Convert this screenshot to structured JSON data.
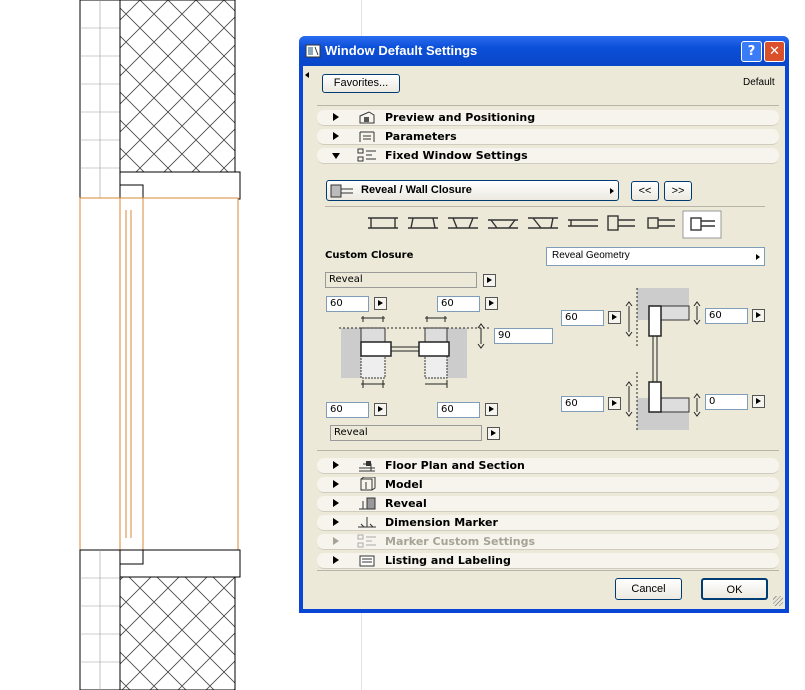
{
  "dialog": {
    "title": "Window Default Settings",
    "help_label": "?",
    "close_label": "✕",
    "favorites_label": "Favorites...",
    "default_label": "Default",
    "sections_top": [
      {
        "label": "Preview and Positioning",
        "expanded": false
      },
      {
        "label": "Parameters",
        "expanded": false
      },
      {
        "label": "Fixed Window Settings",
        "expanded": true
      }
    ],
    "sections_bottom": [
      {
        "label": "Floor Plan and Section",
        "enabled": true
      },
      {
        "label": "Model",
        "enabled": true
      },
      {
        "label": "Reveal",
        "enabled": true
      },
      {
        "label": "Dimension Marker",
        "enabled": true
      },
      {
        "label": "Marker Custom Settings",
        "enabled": false
      },
      {
        "label": "Listing and Labeling",
        "enabled": true
      }
    ],
    "fixed": {
      "page_selector": "Reveal / Wall Closure",
      "prev_label": "<<",
      "next_label": ">>",
      "custom_closure_label": "Custom Closure",
      "reveal_geometry": "Reveal Geometry",
      "reveal_top": "Reveal",
      "reveal_bottom": "Reveal",
      "left_top_a": "60",
      "left_top_b": "60",
      "left_mid": "90",
      "left_bot_a": "60",
      "left_bot_b": "60",
      "right_top_a": "60",
      "right_top_b": "60",
      "right_bot_a": "60",
      "right_bot_b": "0"
    },
    "cancel_label": "Cancel",
    "ok_label": "OK"
  }
}
